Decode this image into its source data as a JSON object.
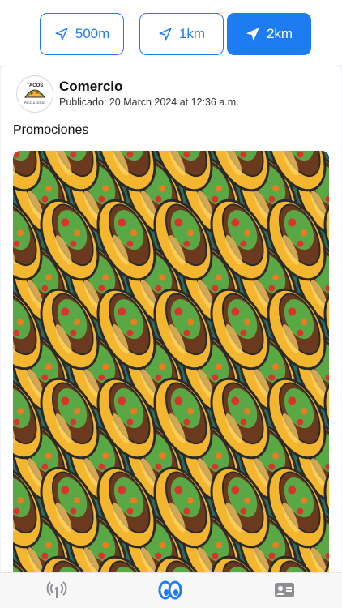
{
  "filters": [
    {
      "label": "500m",
      "icon": "location-arrow-icon",
      "active": false
    },
    {
      "label": "1km",
      "icon": "location-arrow-icon",
      "active": false
    },
    {
      "label": "2km",
      "icon": "location-arrow-icon",
      "active": true
    }
  ],
  "post": {
    "merchant_name": "Comercio",
    "published": "Publicado: 20 March 2024 at 12:36 a.m.",
    "logo": {
      "top_text": "TACOS",
      "bottom_text": "RICO & GOOD"
    }
  },
  "section_title": "Promociones",
  "tabs": [
    {
      "name": "broadcast-icon",
      "active": false
    },
    {
      "name": "eyes-icon",
      "active": true
    },
    {
      "name": "contact-card-icon",
      "active": false
    }
  ],
  "colors": {
    "accent": "#1e7cf2",
    "inactive": "#8e8e93"
  }
}
